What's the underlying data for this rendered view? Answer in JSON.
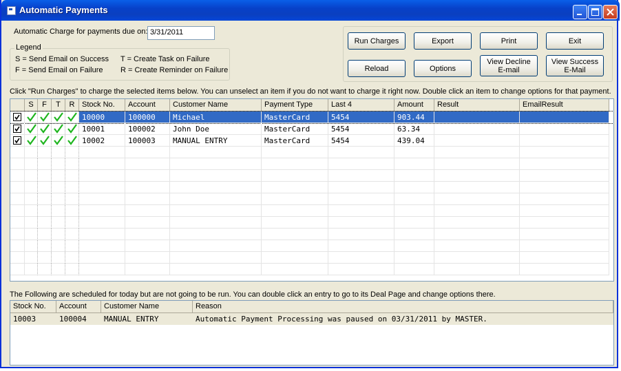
{
  "window": {
    "title": "Automatic Payments"
  },
  "charge_date": {
    "label": "Automatic Charge for payments due on:",
    "value": "3/31/2011"
  },
  "legend": {
    "caption": "Legend",
    "s": "S = Send Email on Success",
    "f": "F = Send Email on Failure",
    "t": "T = Create Task on Failure",
    "r": "R = Create Reminder on Failure"
  },
  "buttons": {
    "run_charges": "Run Charges",
    "export": "Export",
    "print": "Print",
    "exit": "Exit",
    "reload": "Reload",
    "options": "Options",
    "view_decline_1": "View Decline",
    "view_decline_2": "E-mail",
    "view_success_1": "View Success",
    "view_success_2": "E-Mail"
  },
  "instructions": {
    "top": "Click \"Run Charges\" to charge the selected items below. You can unselect an item if you do not want to charge it right now. Double click an item to change options for that payment.",
    "bottom": "The Following are scheduled for today but are not going to be run. You can double click an entry to go to its Deal Page and change options there."
  },
  "payments_table": {
    "columns": [
      "",
      "S",
      "F",
      "T",
      "R",
      "Stock No.",
      "Account",
      "Customer Name",
      "Payment Type",
      "Last 4",
      "Amount",
      "Result",
      "EmailResult"
    ],
    "rows": [
      {
        "stock_no": "10000",
        "account": "100000",
        "customer": "Michael",
        "payment_type": "MasterCard",
        "last4": "5454",
        "amount": "903.44",
        "result": "",
        "email_result": "",
        "checked": true,
        "s": true,
        "f": true,
        "t": true,
        "r": true,
        "selected": true
      },
      {
        "stock_no": "10001",
        "account": "100002",
        "customer": "John Doe",
        "payment_type": "MasterCard",
        "last4": "5454",
        "amount": "63.34",
        "result": "",
        "email_result": "",
        "checked": true,
        "s": true,
        "f": true,
        "t": true,
        "r": true,
        "selected": false
      },
      {
        "stock_no": "10002",
        "account": "100003",
        "customer": "MANUAL ENTRY",
        "payment_type": "MasterCard",
        "last4": "5454",
        "amount": "439.04",
        "result": "",
        "email_result": "",
        "checked": true,
        "s": true,
        "f": true,
        "t": true,
        "r": true,
        "selected": false
      }
    ]
  },
  "skipped_table": {
    "columns": [
      "Stock No.",
      "Account",
      "Customer Name",
      "Reason"
    ],
    "rows": [
      {
        "stock_no": "10003",
        "account": "100004",
        "customer": "MANUAL ENTRY",
        "reason": "Automatic Payment Processing was paused on 03/31/2011 by MASTER."
      }
    ]
  },
  "colors": {
    "selection": "#316ac5",
    "tick": "#1fb51f",
    "titlebar": "#0a3fc0"
  },
  "icons": [
    "app-icon",
    "minimize-icon",
    "maximize-icon",
    "close-icon",
    "checkmark-icon",
    "checkbox-icon"
  ]
}
